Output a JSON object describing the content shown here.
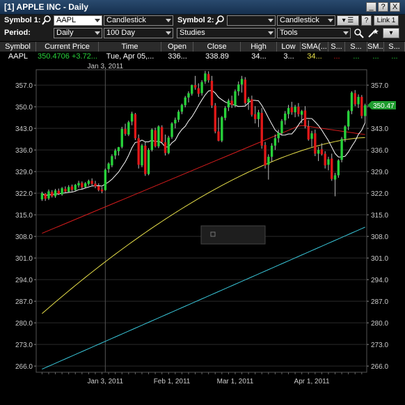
{
  "window": {
    "title": "[1] APPLE INC - Daily",
    "buttons": [
      "_",
      "?",
      "X"
    ]
  },
  "toolbar": {
    "symbol1_label": "Symbol 1:",
    "symbol1_value": "AAPL",
    "chart_type1": "Candlestick",
    "symbol2_label": "Symbol 2:",
    "symbol2_value": "",
    "chart_type2": "Candlestick",
    "period_label": "Period:",
    "period_value": "Daily",
    "range_value": "100 Day",
    "studies": "Studies",
    "tools": "Tools",
    "link": "Link 1",
    "help": "?"
  },
  "quote_table": {
    "headers": [
      "Symbol",
      "Current Price",
      "Time",
      "Open",
      "Close",
      "High",
      "Low",
      "SMA(...",
      "S...",
      "S...",
      "SM...",
      "S...",
      "S..."
    ],
    "row": [
      "AAPL",
      "350.4706 +3.72...",
      "Tue, Apr 05,...",
      "336...",
      "338.89",
      "34...",
      "3...",
      "34...",
      "...",
      "...",
      "...",
      "...",
      "..."
    ]
  },
  "colors": {
    "up": "#27d23a",
    "down": "#e01818",
    "sma_white": "#ffffff",
    "sma_red": "#d41c1c",
    "sma_yellow": "#e8e04a",
    "sma_cyan": "#39c6d9",
    "price_tag": "#1e9c2e"
  },
  "chart_data": {
    "type": "candlestick",
    "ylim": [
      264,
      362
    ],
    "yticks": [
      266.0,
      273.0,
      280.0,
      287.0,
      294.0,
      301.0,
      308.0,
      315.0,
      322.0,
      329.0,
      336.0,
      343.0,
      350.0,
      357.0
    ],
    "xticks": [
      {
        "label": "Jan 3, 2011",
        "idx": 19
      },
      {
        "label": "Feb 1, 2011",
        "idx": 39
      },
      {
        "label": "Mar 1, 2011",
        "idx": 58
      },
      {
        "label": "Apr 1, 2011",
        "idx": 81
      }
    ],
    "top_date_label": "Jan 3, 2011",
    "current_price_label": "350.47",
    "candles": [
      [
        320.0,
        322.5,
        319.5,
        322.0
      ],
      [
        321.8,
        322.0,
        319.5,
        320.2
      ],
      [
        320.3,
        323.2,
        319.8,
        322.6
      ],
      [
        322.4,
        323.0,
        320.6,
        321.0
      ],
      [
        321.0,
        323.4,
        320.5,
        322.9
      ],
      [
        322.8,
        323.5,
        321.4,
        321.8
      ],
      [
        321.6,
        324.0,
        321.2,
        323.6
      ],
      [
        323.4,
        324.2,
        322.1,
        322.5
      ],
      [
        322.5,
        324.6,
        322.1,
        324.0
      ],
      [
        324.2,
        324.8,
        322.6,
        323.1
      ],
      [
        323.0,
        325.0,
        322.8,
        324.7
      ],
      [
        324.5,
        326.0,
        323.8,
        325.3
      ],
      [
        325.3,
        325.8,
        323.2,
        323.9
      ],
      [
        324.0,
        325.6,
        323.5,
        325.2
      ],
      [
        325.0,
        326.4,
        324.4,
        326.0
      ],
      [
        326.0,
        326.8,
        324.5,
        325.0
      ],
      [
        325.1,
        326.0,
        323.6,
        324.2
      ],
      [
        324.3,
        325.2,
        322.6,
        323.0
      ],
      [
        323.2,
        324.0,
        322.0,
        322.6
      ],
      [
        323.0,
        330.0,
        322.8,
        329.6
      ],
      [
        329.8,
        332.0,
        328.6,
        331.6
      ],
      [
        331.0,
        334.6,
        330.4,
        334.0
      ],
      [
        334.2,
        336.4,
        333.0,
        335.8
      ],
      [
        335.6,
        337.0,
        334.2,
        336.9
      ],
      [
        337.0,
        343.5,
        336.5,
        342.8
      ],
      [
        342.8,
        344.5,
        340.6,
        341.2
      ],
      [
        341.0,
        345.5,
        340.5,
        345.0
      ],
      [
        345.2,
        348.4,
        344.0,
        347.8
      ],
      [
        347.6,
        348.0,
        339.2,
        339.8
      ],
      [
        339.8,
        341.0,
        330.0,
        331.2
      ],
      [
        331.0,
        338.0,
        330.4,
        337.5
      ],
      [
        337.4,
        338.6,
        327.6,
        328.2
      ],
      [
        328.2,
        336.6,
        327.8,
        336.0
      ],
      [
        336.0,
        343.0,
        335.5,
        342.6
      ],
      [
        342.4,
        343.2,
        336.8,
        337.2
      ],
      [
        337.2,
        344.0,
        336.6,
        343.6
      ],
      [
        343.4,
        344.0,
        338.0,
        338.6
      ],
      [
        338.5,
        341.0,
        334.2,
        335.0
      ],
      [
        335.0,
        340.6,
        334.6,
        340.0
      ],
      [
        340.2,
        345.0,
        339.6,
        344.6
      ],
      [
        344.6,
        346.5,
        343.0,
        345.8
      ],
      [
        345.8,
        349.0,
        345.0,
        348.4
      ],
      [
        348.4,
        351.0,
        347.6,
        350.6
      ],
      [
        350.5,
        353.5,
        349.8,
        353.0
      ],
      [
        353.0,
        355.0,
        351.4,
        354.4
      ],
      [
        354.2,
        357.2,
        353.6,
        357.0
      ],
      [
        357.0,
        360.0,
        355.5,
        356.2
      ],
      [
        356.0,
        357.6,
        353.2,
        354.2
      ],
      [
        354.4,
        358.6,
        353.6,
        358.0
      ],
      [
        358.2,
        361.6,
        357.4,
        360.8
      ],
      [
        360.6,
        361.5,
        357.8,
        358.6
      ],
      [
        358.4,
        360.0,
        349.6,
        350.4
      ],
      [
        350.4,
        351.2,
        341.4,
        342.0
      ],
      [
        342.0,
        346.5,
        338.8,
        339.0
      ],
      [
        339.0,
        347.0,
        338.5,
        346.6
      ],
      [
        346.4,
        350.2,
        345.6,
        349.6
      ],
      [
        349.8,
        352.6,
        348.6,
        352.0
      ],
      [
        352.0,
        353.6,
        349.6,
        350.6
      ],
      [
        350.4,
        355.6,
        349.8,
        355.0
      ],
      [
        355.0,
        358.2,
        353.6,
        357.2
      ],
      [
        357.2,
        360.0,
        354.6,
        359.0
      ],
      [
        358.8,
        359.6,
        350.6,
        351.2
      ],
      [
        351.4,
        353.2,
        349.0,
        352.6
      ],
      [
        352.4,
        353.6,
        346.8,
        347.4
      ],
      [
        347.6,
        350.2,
        344.6,
        346.0
      ],
      [
        346.0,
        349.0,
        343.4,
        348.2
      ],
      [
        348.0,
        349.6,
        336.4,
        337.4
      ],
      [
        337.6,
        338.6,
        330.0,
        331.0
      ],
      [
        331.2,
        334.6,
        326.4,
        333.8
      ],
      [
        333.8,
        338.2,
        332.2,
        337.4
      ],
      [
        337.4,
        341.0,
        336.0,
        339.8
      ],
      [
        339.8,
        342.6,
        338.4,
        341.6
      ],
      [
        341.4,
        346.0,
        340.8,
        345.4
      ],
      [
        345.6,
        348.6,
        344.2,
        347.8
      ],
      [
        347.6,
        350.6,
        346.2,
        349.6
      ],
      [
        349.8,
        351.6,
        347.4,
        348.2
      ],
      [
        348.2,
        350.6,
        346.6,
        350.0
      ],
      [
        350.0,
        351.2,
        346.8,
        347.6
      ],
      [
        347.4,
        349.0,
        344.6,
        348.6
      ],
      [
        348.8,
        350.2,
        343.0,
        343.8
      ],
      [
        343.6,
        345.6,
        339.0,
        339.4
      ],
      [
        339.6,
        342.2,
        337.0,
        341.4
      ],
      [
        341.4,
        342.6,
        334.0,
        334.8
      ],
      [
        334.8,
        337.0,
        332.4,
        336.0
      ],
      [
        336.2,
        338.2,
        334.2,
        334.6
      ],
      [
        334.8,
        335.6,
        330.0,
        331.0
      ],
      [
        331.2,
        333.8,
        329.4,
        333.0
      ],
      [
        333.2,
        334.8,
        326.0,
        326.6
      ],
      [
        326.4,
        328.6,
        321.0,
        327.8
      ],
      [
        327.8,
        333.0,
        327.0,
        332.6
      ],
      [
        332.8,
        340.2,
        332.0,
        339.6
      ],
      [
        339.6,
        344.0,
        338.6,
        343.6
      ],
      [
        343.6,
        349.0,
        342.4,
        348.6
      ],
      [
        348.6,
        355.0,
        347.6,
        354.6
      ],
      [
        354.4,
        355.4,
        350.2,
        350.8
      ],
      [
        350.8,
        354.0,
        349.6,
        353.2
      ],
      [
        353.2,
        353.8,
        346.2,
        347.0
      ],
      [
        347.0,
        351.0,
        344.8,
        350.47
      ]
    ]
  }
}
